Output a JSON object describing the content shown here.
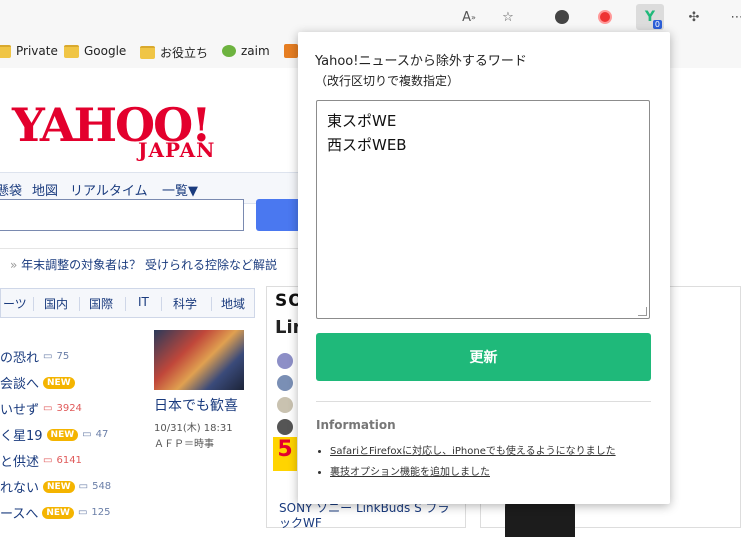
{
  "browser": {
    "toolbar": {
      "reader_icon": "read-aloud-icon",
      "favorite_icon": "star-icon",
      "extension_badge": "0",
      "puzzle_icon": "extensions-icon"
    },
    "bookmarks": [
      {
        "label": "Private"
      },
      {
        "label": "Google"
      },
      {
        "label": "お役立ち"
      },
      {
        "label": "zaim"
      }
    ]
  },
  "yahoo": {
    "logo": "YAHOO!",
    "logo_sub": "JAPAN",
    "nav": [
      "懸袋",
      "地図",
      "リアルタイム",
      "一覧▼"
    ],
    "ticker": "年末調整の対象者は？ 受けられる控除など解説",
    "categories": [
      "ーツ",
      "国内",
      "国際",
      "IT",
      "科学",
      "地域"
    ],
    "news": [
      {
        "text": "の恐れ",
        "badge": "",
        "count": "75",
        "red": false
      },
      {
        "text": "会談へ",
        "badge": "NEW",
        "count": "",
        "red": false
      },
      {
        "text": "いせず",
        "badge": "",
        "count": "3924",
        "red": true
      },
      {
        "text": "く星19",
        "badge": "NEW",
        "count": "47",
        "red": false
      },
      {
        "text": "と供述",
        "badge": "",
        "count": "6141",
        "red": true
      },
      {
        "text": "れない",
        "badge": "NEW",
        "count": "548",
        "red": false
      },
      {
        "text": "ースへ",
        "badge": "NEW",
        "count": "125",
        "red": false
      }
    ],
    "photo": {
      "caption": "日本でも歓喜",
      "time": "10/31(木) 18:31",
      "source": "ＡＦＰ＝時事"
    },
    "ad": {
      "brand": "SO",
      "sub": "Lin",
      "sale": "5",
      "title_line1": "SONY ソニー LinkBuds S ブラ",
      "title_line2": "ックWF"
    }
  },
  "popup": {
    "title": "Yahoo!ニュースから除外するワード",
    "subtitle": "（改行区切りで複数指定）",
    "textarea_value": "東スポWE\n西スポWEB",
    "update_button": "更新",
    "info_heading": "Information",
    "info_items": [
      "SafariとFirefoxに対応し、iPhoneでも使えるようになりました",
      "裏技オプション機能を追加しました"
    ]
  },
  "colors": {
    "yahoo_red": "#e3002d",
    "button_green": "#1fb97a",
    "link_blue": "#1a3b7e"
  }
}
